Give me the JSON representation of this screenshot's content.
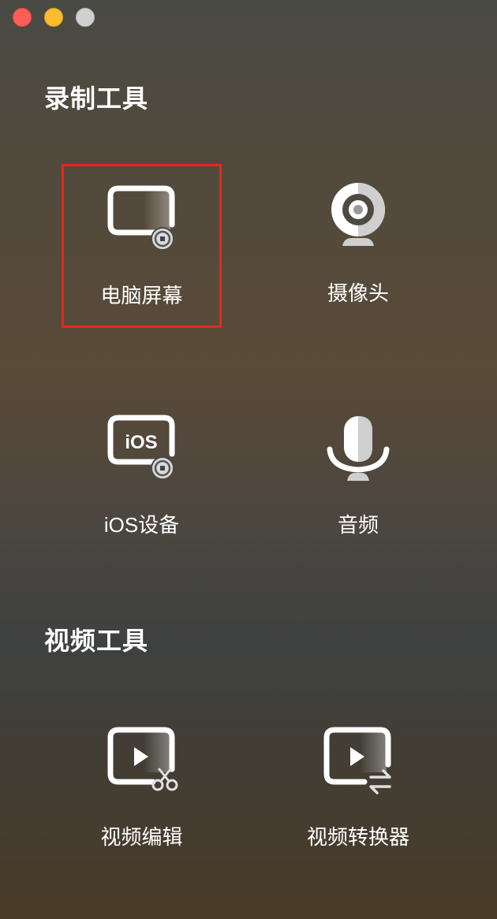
{
  "window": {
    "controls": [
      "close",
      "minimize",
      "zoom"
    ]
  },
  "sections": {
    "record": {
      "title": "录制工具",
      "items": [
        {
          "label": "电脑屏幕",
          "icon": "screen-record-icon",
          "selected": true
        },
        {
          "label": "摄像头",
          "icon": "webcam-icon",
          "selected": false
        },
        {
          "label": "iOS设备",
          "icon": "ios-device-icon",
          "icon_text": "iOS",
          "selected": false
        },
        {
          "label": "音频",
          "icon": "microphone-icon",
          "selected": false
        }
      ]
    },
    "video": {
      "title": "视频工具",
      "items": [
        {
          "label": "视频编辑",
          "icon": "video-edit-icon"
        },
        {
          "label": "视频转换器",
          "icon": "video-convert-icon"
        }
      ]
    }
  },
  "colors": {
    "selection_border": "#e8261a",
    "close": "#fc5f57",
    "minimize": "#fdbb2e",
    "zoom": "#d0d0d0"
  }
}
